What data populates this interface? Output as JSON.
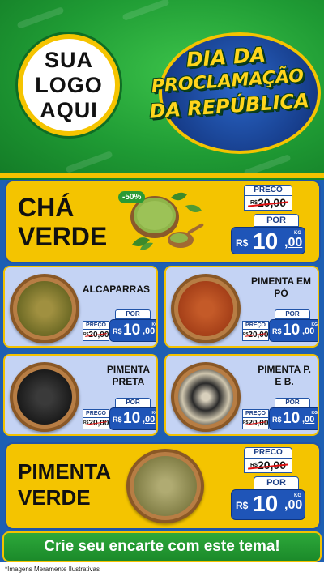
{
  "header": {
    "logo_lines": [
      "SUA",
      "LOGO",
      "AQUI"
    ],
    "headline": [
      "DIA DA",
      "PROCLAMAÇÃO",
      "DA REPÚBLICA"
    ]
  },
  "featured": [
    {
      "name_lines": [
        "CHÁ",
        "VERDE"
      ],
      "discount": "-50%",
      "price_label": "PRECO",
      "old_currency": "R$",
      "old_price": "20,00",
      "por_label": "POR",
      "currency": "R$",
      "price_int": "10",
      "price_cents": ",00",
      "unit": "KG"
    },
    {
      "name_lines": [
        "PIMENTA",
        "VERDE"
      ],
      "price_label": "PRECO",
      "old_currency": "R$",
      "old_price": "20,00",
      "por_label": "POR",
      "currency": "R$",
      "price_int": "10",
      "price_cents": ",00",
      "unit": "KG"
    }
  ],
  "products": [
    {
      "name_lines": [
        "ALCAPARRAS",
        ""
      ],
      "price_label": "PREÇO",
      "old_currency": "R$",
      "old_price": "20,00",
      "por_label": "POR",
      "currency": "R$",
      "price_int": "10",
      "price_cents": ",00",
      "unit": "KG"
    },
    {
      "name_lines": [
        "PIMENTA EM",
        "PÓ"
      ],
      "price_label": "PREÇO",
      "old_currency": "R$",
      "old_price": "20,00",
      "por_label": "POR",
      "currency": "R$",
      "price_int": "10",
      "price_cents": ",00",
      "unit": "KG"
    },
    {
      "name_lines": [
        "PIMENTA",
        "PRETA"
      ],
      "price_label": "PREÇO",
      "old_currency": "R$",
      "old_price": "20,00",
      "por_label": "POR",
      "currency": "R$",
      "price_int": "10",
      "price_cents": ",00",
      "unit": "KG"
    },
    {
      "name_lines": [
        "PIMENTA P.",
        "E B."
      ],
      "price_label": "PREÇO",
      "old_currency": "R$",
      "old_price": "20,00",
      "por_label": "POR",
      "currency": "R$",
      "price_int": "10",
      "price_cents": ",00",
      "unit": "KG"
    }
  ],
  "cta": "Crie seu encarte com este tema!",
  "disclaimer": "*Imagens Meramente Ilustrativas",
  "colors": {
    "green": "#1f9b34",
    "yellow": "#f4c400",
    "blue": "#1f55b8",
    "card_bg": "#c4d3f4"
  }
}
